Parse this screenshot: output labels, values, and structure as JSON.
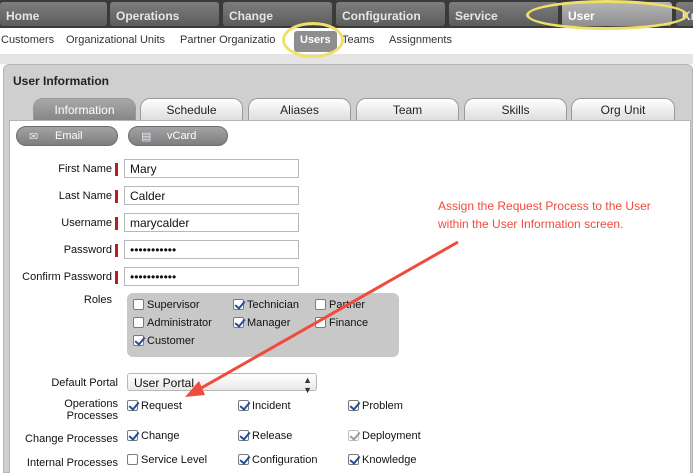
{
  "nav": {
    "tabs": [
      {
        "label": "Home"
      },
      {
        "label": "Operations"
      },
      {
        "label": "Change"
      },
      {
        "label": "Configuration"
      },
      {
        "label": "Service"
      },
      {
        "label": "User"
      },
      {
        "label": "Kr"
      }
    ]
  },
  "subnav": {
    "items": [
      {
        "label": "Customers"
      },
      {
        "label": "Organizational Units"
      },
      {
        "label": "Partner Organizatio"
      },
      {
        "label": "Users"
      },
      {
        "label": "Teams"
      },
      {
        "label": "Assignments"
      }
    ]
  },
  "panel": {
    "title": "User Information",
    "tabs": [
      {
        "label": "Information"
      },
      {
        "label": "Schedule"
      },
      {
        "label": "Aliases"
      },
      {
        "label": "Team"
      },
      {
        "label": "Skills"
      },
      {
        "label": "Org Unit"
      }
    ]
  },
  "actions": {
    "email_label": "Email",
    "vcard_label": "vCard"
  },
  "form": {
    "first_name": {
      "label": "First Name",
      "value": "Mary"
    },
    "last_name": {
      "label": "Last Name",
      "value": "Calder"
    },
    "username": {
      "label": "Username",
      "value": "marycalder"
    },
    "password": {
      "label": "Password",
      "value": "•••••••••••"
    },
    "confirm_password": {
      "label": "Confirm Password",
      "value": "•••••••••••"
    },
    "roles_label": "Roles",
    "roles": [
      {
        "label": "Supervisor",
        "checked": false
      },
      {
        "label": "Technician",
        "checked": true
      },
      {
        "label": "Partner",
        "checked": false
      },
      {
        "label": "Administrator",
        "checked": false
      },
      {
        "label": "Manager",
        "checked": true
      },
      {
        "label": "Finance",
        "checked": false
      },
      {
        "label": "Customer",
        "checked": true
      }
    ],
    "default_portal": {
      "label": "Default Portal",
      "value": "User Portal"
    },
    "operations_label_1": "Operations",
    "operations_label_2": "Processes",
    "operations": [
      {
        "label": "Request",
        "checked": true
      },
      {
        "label": "Incident",
        "checked": true
      },
      {
        "label": "Problem",
        "checked": true
      }
    ],
    "change_label": "Change Processes",
    "change": [
      {
        "label": "Change",
        "checked": true
      },
      {
        "label": "Release",
        "checked": true
      },
      {
        "label": "Deployment",
        "checked": true,
        "disabled": true
      }
    ],
    "internal_label": "Internal Processes",
    "internal": [
      {
        "label": "Service Level",
        "checked": false
      },
      {
        "label": "Configuration",
        "checked": true
      },
      {
        "label": "Knowledge",
        "checked": true
      }
    ]
  },
  "annotation": {
    "line1": "Assign the Request Process to the User",
    "line2": "within the User Information screen.",
    "color": "#f04b3c",
    "highlight_color": "#efe06a"
  }
}
